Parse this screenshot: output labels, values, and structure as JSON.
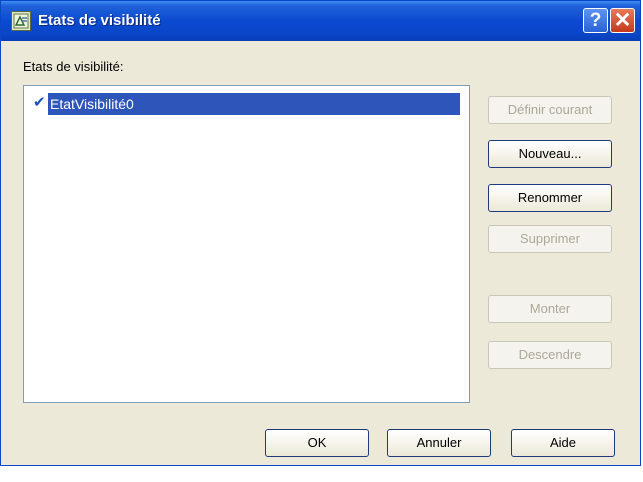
{
  "window": {
    "title": "Etats de visibilité"
  },
  "titlebar_buttons": {
    "help": "?",
    "close": "✕"
  },
  "list": {
    "label": "Etats de visibilité:",
    "items": [
      {
        "label": "EtatVisibilité0",
        "checked": true,
        "selected": true
      }
    ],
    "check_symbol": "✔"
  },
  "side_buttons": {
    "define_current": {
      "label": "Définir courant",
      "enabled": false
    },
    "new": {
      "label": "Nouveau...",
      "enabled": true
    },
    "rename": {
      "label": "Renommer",
      "enabled": true
    },
    "delete": {
      "label": "Supprimer",
      "enabled": false
    },
    "move_up": {
      "label": "Monter",
      "enabled": false
    },
    "move_down": {
      "label": "Descendre",
      "enabled": false
    }
  },
  "bottom_buttons": {
    "ok": "OK",
    "cancel": "Annuler",
    "help": "Aide"
  },
  "colors": {
    "titlebar": "#0b4ad0",
    "selection": "#2e55b9",
    "dialog_bg": "#ece9d8",
    "check": "#1c4fb8"
  },
  "icons": {
    "app": "block-editor-icon",
    "help": "help-icon",
    "close": "close-icon",
    "check": "check-icon"
  }
}
